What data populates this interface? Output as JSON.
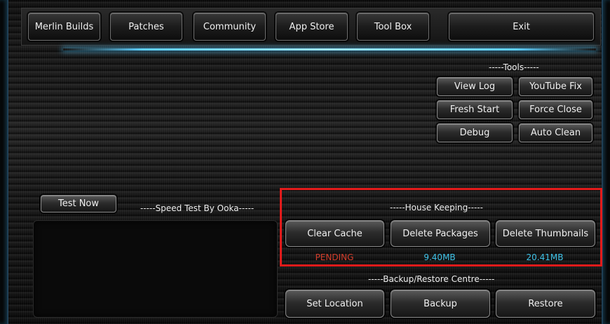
{
  "topnav": {
    "items": [
      "Merlin Builds",
      "Patches",
      "Community",
      "App Store",
      "Tool Box"
    ],
    "exit_label": "Exit"
  },
  "tools": {
    "heading": "-----Tools-----",
    "buttons": [
      "View Log",
      "YouTube Fix",
      "Fresh Start",
      "Force Close",
      "Debug",
      "Auto Clean"
    ]
  },
  "speedtest": {
    "button_label": "Test Now",
    "heading": "-----Speed Test By Ooka-----"
  },
  "housekeeping": {
    "heading": "-----House Keeping-----",
    "buttons": [
      "Clear Cache",
      "Delete Packages",
      "Delete Thumbnails"
    ],
    "statuses": [
      "PENDING",
      "9.40MB",
      "20.41MB"
    ]
  },
  "backup": {
    "heading": "-----Backup/Restore Centre-----",
    "buttons": [
      "Set Location",
      "Backup",
      "Restore"
    ]
  },
  "colors": {
    "pending": "#d23c2a",
    "size": "#3fc3e8",
    "highlight": "#e31b1b",
    "accent_glow": "#5fd0ff"
  }
}
